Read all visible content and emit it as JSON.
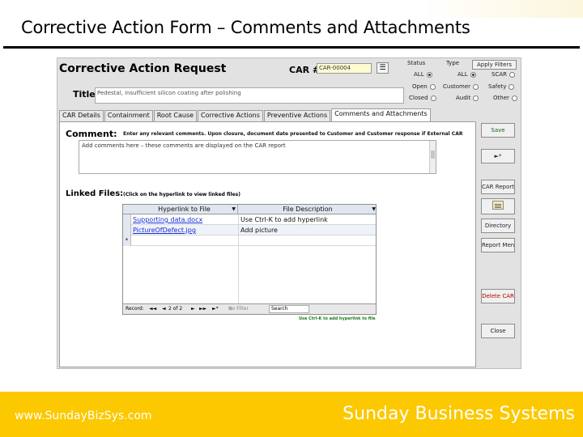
{
  "slide": {
    "title": "Corrective Action Form – Comments and Attachments",
    "footer_url": "www.SundayBizSys.com",
    "footer_company": "Sunday Business Systems",
    "footer_color": "#fcc800"
  },
  "form": {
    "heading": "Corrective Action Request",
    "car_label": "CAR #:",
    "car_value": "CAR-00004",
    "car_lookup_icon": "list-icon",
    "title_label": "Title:",
    "title_value": "Pedestal, insufficient silicon coating after polishing",
    "apply_filters": "Apply Filters",
    "status": {
      "label": "Status",
      "options": [
        "ALL",
        "Open",
        "Closed"
      ],
      "selected": "ALL"
    },
    "type": {
      "label": "Type",
      "options": [
        "ALL",
        "Customer",
        "Audit",
        "SCAR",
        "Safety",
        "Other"
      ],
      "selected": "ALL"
    }
  },
  "tabs": [
    "CAR Details",
    "Containment",
    "Root Cause",
    "Corrective Actions",
    "Preventive Actions",
    "Comments and Attachments"
  ],
  "active_tab": "Comments and Attachments",
  "comments": {
    "label": "Comment:",
    "hint": "Enter any relevant comments. Upon closure, document date presented to Customer and Customer response if External CAR",
    "value": "Add comments here – these comments are displayed on the CAR report"
  },
  "linked_files": {
    "label": "Linked Files:",
    "hint": "(Click on the hyperlink to view linked files)",
    "columns": [
      "Hyperlink to File",
      "File Description"
    ],
    "rows": [
      {
        "file": "Supporting data.docx",
        "description": "Use Ctrl-K to add hyperlink"
      },
      {
        "file": "PictureOfDefect.jpg",
        "description": "Add picture"
      }
    ],
    "new_row_marker": "*",
    "nav": {
      "record_label": "Record:",
      "position": "2 of 2",
      "filter": "No Filter",
      "search": "Search"
    },
    "add_hint": "Use Ctrl-K to add hyperlink to file"
  },
  "side_buttons": {
    "save": "Save",
    "next": "►*",
    "car_report": "CAR Report",
    "report_icon": "report-icon",
    "directory": "Directory",
    "report_menu": "Report Menu",
    "delete": "Delete CAR",
    "close": "Close"
  }
}
